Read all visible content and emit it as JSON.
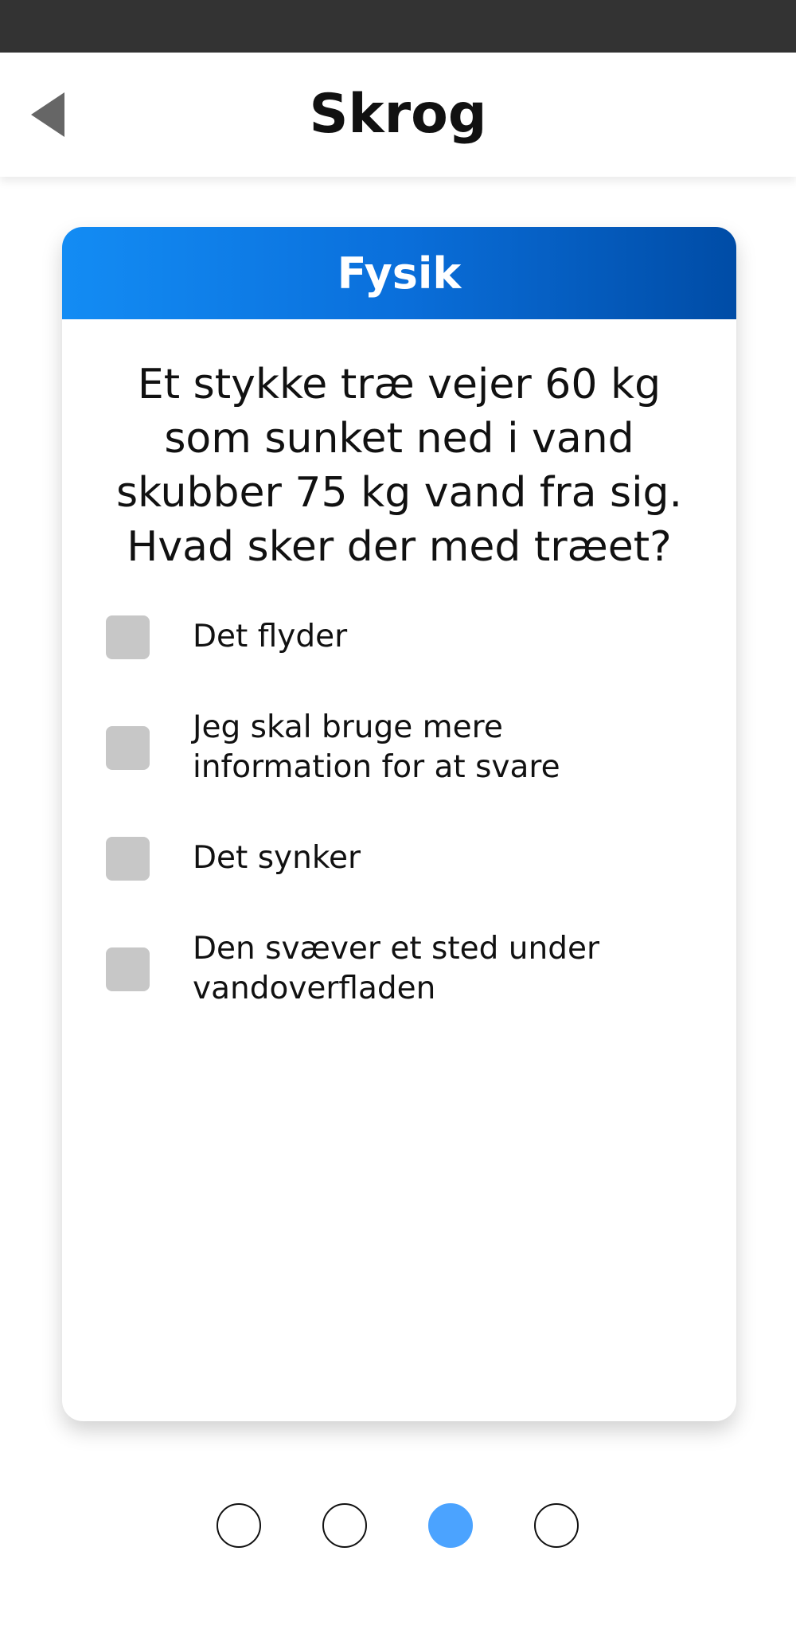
{
  "header": {
    "title": "Skrog",
    "back_icon": "back-triangle-icon"
  },
  "card": {
    "category": "Fysik",
    "question": "Et stykke træ vejer 60 kg som sunket ned i vand skubber 75 kg vand fra sig. Hvad sker der med træet?",
    "options": [
      {
        "label": "Det flyder"
      },
      {
        "label": "Jeg skal bruge mere information for at svare"
      },
      {
        "label": "Det synker"
      },
      {
        "label": "Den svæver et sted under vandoverfladen"
      }
    ]
  },
  "pagination": {
    "total": 4,
    "current": 3,
    "active_color": "#4ba3ff"
  },
  "colors": {
    "status_bar": "#333333",
    "card_header_start": "#138cf4",
    "card_header_end": "#004ca6",
    "checkbox": "#c7c7c7"
  }
}
